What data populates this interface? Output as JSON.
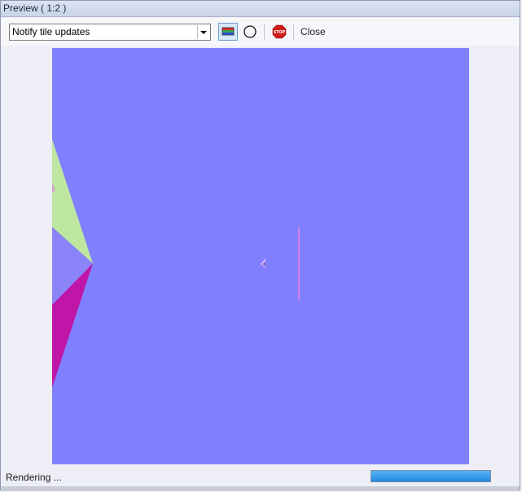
{
  "window": {
    "title": "Preview ( 1:2 )"
  },
  "toolbar": {
    "dropdown_value": "Notify tile updates",
    "close_label": "Close"
  },
  "icons": {
    "channels": "color-channels-icon",
    "circle": "circle-icon",
    "stop": "stop-icon",
    "stop_text": "STOP"
  },
  "status": {
    "text": "Rendering ...",
    "progress": 1.0
  },
  "colors": {
    "background": "#8080ff",
    "accent": "#1e88e0"
  }
}
